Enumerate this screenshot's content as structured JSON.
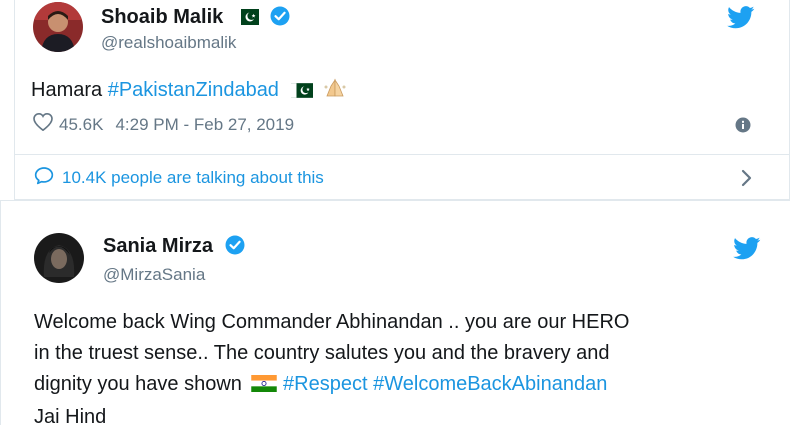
{
  "tweets": [
    {
      "name": "Shoaib Malik",
      "handle": "@realshoaibmalik",
      "text_prefix": "Hamara ",
      "hashtag": "#PakistanZindabad",
      "likes": "45.6K",
      "timestamp": "4:29 PM - Feb 27, 2019",
      "talking": "10.4K people are talking about this",
      "flag": "pakistan-flag",
      "emoji": "folded-hands"
    },
    {
      "name": "Sania Mirza",
      "handle": "@MirzaSania",
      "line1": "Welcome back Wing Commander Abhinandan .. you are our HERO",
      "line2": "in the truest sense.. The country salutes you and the bravery and",
      "line3_prefix": "dignity you have shown",
      "hashtag1": "#Respect",
      "hashtag2": "#WelcomeBackAbinandan",
      "line4": "Jai Hind",
      "flag": "india-flag"
    }
  ],
  "colors": {
    "link": "#1b95e0",
    "twitter_blue": "#1da1f2",
    "muted": "#657786",
    "border": "#e1e8ed"
  }
}
